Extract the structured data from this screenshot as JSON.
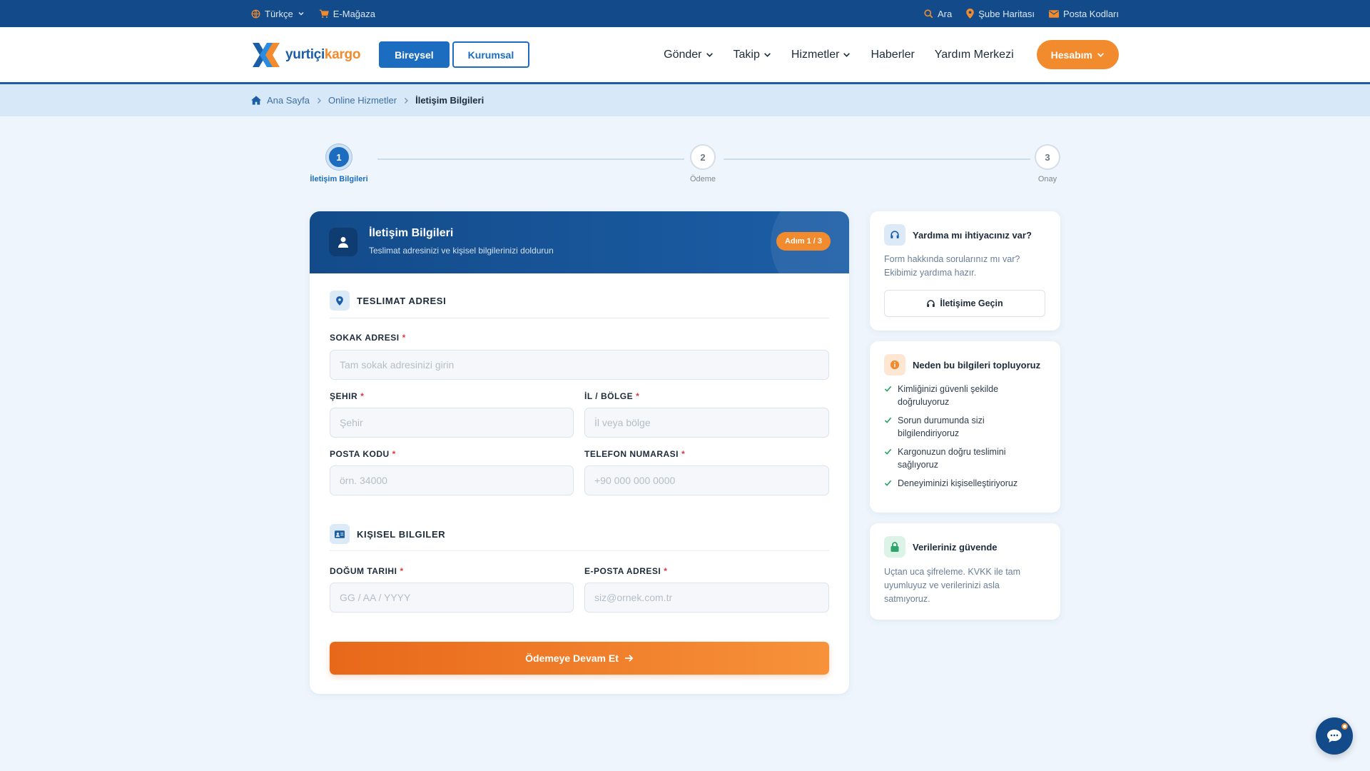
{
  "topbar": {
    "language": "Türkçe",
    "emagaza": "E-Mağaza",
    "search": "Ara",
    "branch_map": "Şube Haritası",
    "postal_codes": "Posta Kodları"
  },
  "header": {
    "logo_text_a": "yurtiçi",
    "logo_text_b": "kargo",
    "segment_individual": "Bireysel",
    "segment_corporate": "Kurumsal",
    "nav": [
      "Gönder",
      "Takip",
      "Hizmetler",
      "Haberler",
      "Yardım Merkezi"
    ],
    "account": "Hesabım"
  },
  "breadcrumb": {
    "home": "Ana Sayfa",
    "online": "Online Hizmetler",
    "current": "İletişim Bilgileri"
  },
  "stepper": {
    "steps": [
      {
        "number": "1",
        "label": "İletişim Bilgileri"
      },
      {
        "number": "2",
        "label": "Ödeme"
      },
      {
        "number": "3",
        "label": "Onay"
      }
    ],
    "active_step": 1
  },
  "form": {
    "title": "İletişim Bilgileri",
    "subtitle": "Teslimat adresinizi ve kişisel bilgilerinizi doldurun",
    "step_badge": "Adım 1 / 3",
    "section_address": "TESLIMAT ADRESI",
    "section_personal": "KIŞISEL BILGILER",
    "fields": {
      "street": {
        "label": "SOKAK ADRESI",
        "placeholder": "Tam sokak adresinizi girin",
        "value": ""
      },
      "city": {
        "label": "ŞEHIR",
        "placeholder": "Şehir",
        "value": ""
      },
      "region": {
        "label": "İL / BÖLGE",
        "placeholder": "İl veya bölge",
        "value": ""
      },
      "postal": {
        "label": "POSTA KODU",
        "placeholder": "örn. 34000",
        "value": ""
      },
      "phone": {
        "label": "TELEFON NUMARASI",
        "placeholder": "+90 000 000 0000",
        "value": ""
      },
      "birth": {
        "label": "DOĞUM TARIHI",
        "placeholder": "GG / AA / YYYY",
        "value": ""
      },
      "email": {
        "label": "E-POSTA ADRESI",
        "placeholder": "siz@ornek.com.tr",
        "value": ""
      }
    },
    "required_mark": "*",
    "submit": "Ödemeye Devam Et"
  },
  "help": {
    "title": "Yardıma mı ihtiyacınız var?",
    "text": "Form hakkında sorularınız mı var? Ekibimiz yardıma hazır.",
    "button": "İletişime Geçin"
  },
  "why": {
    "title": "Neden bu bilgileri topluyoruz",
    "items": [
      "Kimliğinizi güvenli şekilde doğruluyoruz",
      "Sorun durumunda sizi bilgilendiriyoruz",
      "Kargonuzun doğru teslimini sağlıyoruz",
      "Deneyiminizi kişiselleştiriyoruz"
    ]
  },
  "security": {
    "title": "Verileriniz güvende",
    "text": "Uçtan uca şifreleme. KVKK ile tam uyumluyuz ve verilerinizi asla satmıyoruz."
  },
  "colors": {
    "primary": "#1c5ea6",
    "accent": "#f28a2e",
    "topbar": "#134b8a",
    "success": "#2fa36b",
    "required": "#e0393e"
  }
}
